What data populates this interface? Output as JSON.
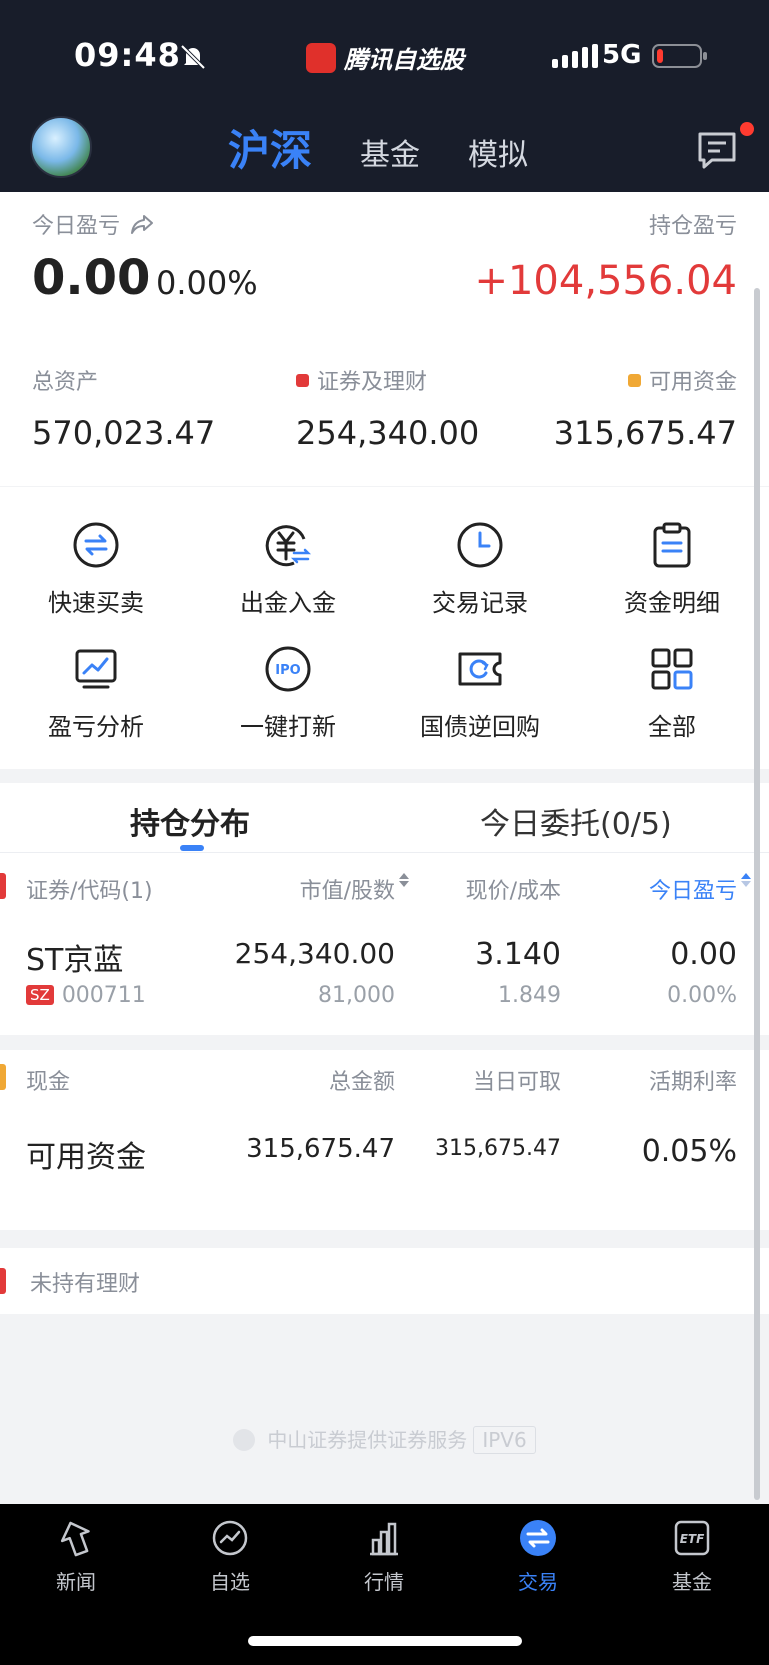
{
  "status_bar": {
    "time": "09:48",
    "app_name": "腾讯自选股",
    "network": "5G"
  },
  "nav": {
    "tabs": [
      {
        "label": "沪深",
        "active": true
      },
      {
        "label": "基金",
        "active": false
      },
      {
        "label": "模拟",
        "active": false
      }
    ]
  },
  "profit": {
    "today_label": "今日盈亏",
    "today_value": "0.00",
    "today_pct": "0.00%",
    "hold_label": "持仓盈亏",
    "hold_value": "+104,556.04"
  },
  "assets": {
    "total_label": "总资产",
    "total_value": "570,023.47",
    "securities_label": "证券及理财",
    "securities_value": "254,340.00",
    "available_label": "可用资金",
    "available_value": "315,675.47"
  },
  "colors": {
    "accent": "#3a82f7",
    "loss_red": "#e23a3a",
    "dark_header": "#181d2a",
    "available_dot": "#f0a835"
  },
  "actions": [
    {
      "label": "快速买卖",
      "icon": "swap-icon"
    },
    {
      "label": "出金入金",
      "icon": "yuan-transfer-icon"
    },
    {
      "label": "交易记录",
      "icon": "clock-icon"
    },
    {
      "label": "资金明细",
      "icon": "clipboard-icon"
    },
    {
      "label": "盈亏分析",
      "icon": "chart-monitor-icon"
    },
    {
      "label": "一键打新",
      "icon": "ipo-icon"
    },
    {
      "label": "国债逆回购",
      "icon": "ticket-icon"
    },
    {
      "label": "全部",
      "icon": "grid-icon"
    }
  ],
  "holdings": {
    "tab_positions": "持仓分布",
    "tab_orders": "今日委托(0/5)",
    "headers": {
      "security": "证券/代码(1)",
      "market_value": "市值/股数",
      "price": "现价/成本",
      "today_pnl": "今日盈亏"
    },
    "row": {
      "name": "ST京蓝",
      "market": "SZ",
      "code": "000711",
      "market_value": "254,340.00",
      "shares": "81,000",
      "price": "3.140",
      "cost": "1.849",
      "today_pnl": "0.00",
      "today_pct": "0.00%"
    }
  },
  "cash": {
    "headers": {
      "title": "现金",
      "total": "总金额",
      "withdrawable": "当日可取",
      "rate": "活期利率"
    },
    "row": {
      "name": "可用资金",
      "total": "315,675.47",
      "withdrawable": "315,675.47",
      "rate": "0.05%"
    }
  },
  "finance": {
    "label": "未持有理财"
  },
  "footer": {
    "provider": "中山证券提供证券服务",
    "ipv6": "IPV6"
  },
  "tabbar": [
    {
      "label": "新闻",
      "icon": "news-icon",
      "active": false
    },
    {
      "label": "自选",
      "icon": "watchlist-icon",
      "active": false
    },
    {
      "label": "行情",
      "icon": "market-icon",
      "active": false
    },
    {
      "label": "交易",
      "icon": "trade-icon",
      "active": true
    },
    {
      "label": "基金",
      "icon": "etf-icon",
      "active": false
    }
  ]
}
